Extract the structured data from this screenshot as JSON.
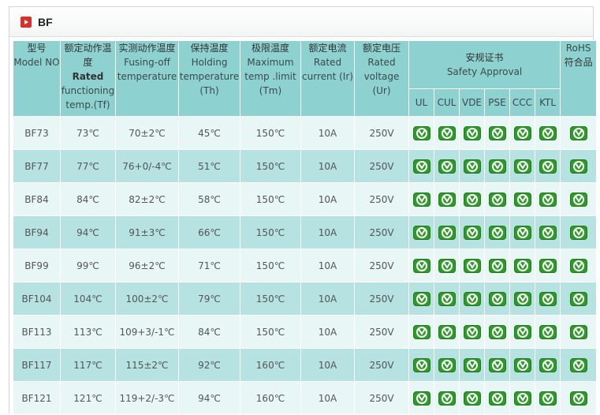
{
  "title": "BF",
  "header": {
    "col_model": {
      "cn": "型号",
      "en": "Model NO"
    },
    "col_rated": {
      "cn": "额定动作温度",
      "bold": "Rated",
      "en": "functioning temp.(Tf)"
    },
    "col_fusing": {
      "cn": "实测动作温度",
      "en": "Fusing-off temperature"
    },
    "col_holding": {
      "cn": "保持温度",
      "en": "Holding temperature (Th)"
    },
    "col_max": {
      "cn": "极限温度",
      "en": "Maximum temp .limit (Tm)"
    },
    "col_current": {
      "cn": "额定电流",
      "en": "Rated current (Ir)"
    },
    "col_voltage": {
      "cn": "额定电压",
      "en": "Rated voltage (Ur)"
    },
    "col_safety": {
      "cn": "安规证书",
      "en": "Safety Approval"
    },
    "col_rohs": {
      "en": "RoHS",
      "cn": "符合品"
    },
    "safety_subs": [
      "UL",
      "CUL",
      "VDE",
      "PSE",
      "CCC",
      "KTL"
    ]
  },
  "badge_icon": "approved-check-icon",
  "badge_color": "#2f9a2a",
  "rows": [
    {
      "model": "BF73",
      "rated": "73℃",
      "fusing": "70±2℃",
      "holding": "45℃",
      "max": "150℃",
      "current": "10A",
      "voltage": "250V"
    },
    {
      "model": "BF77",
      "rated": "77℃",
      "fusing": "76+0/-4℃",
      "holding": "51℃",
      "max": "150℃",
      "current": "10A",
      "voltage": "250V"
    },
    {
      "model": "BF84",
      "rated": "84℃",
      "fusing": "82±2℃",
      "holding": "58℃",
      "max": "150℃",
      "current": "10A",
      "voltage": "250V"
    },
    {
      "model": "BF94",
      "rated": "94℃",
      "fusing": "91±3℃",
      "holding": "66℃",
      "max": "150℃",
      "current": "10A",
      "voltage": "250V"
    },
    {
      "model": "BF99",
      "rated": "99℃",
      "fusing": "96±2℃",
      "holding": "71℃",
      "max": "150℃",
      "current": "10A",
      "voltage": "250V"
    },
    {
      "model": "BF104",
      "rated": "104℃",
      "fusing": "100±2℃",
      "holding": "79℃",
      "max": "150℃",
      "current": "10A",
      "voltage": "250V"
    },
    {
      "model": "BF113",
      "rated": "113℃",
      "fusing": "109+3/-1℃",
      "holding": "84℃",
      "max": "150℃",
      "current": "10A",
      "voltage": "250V"
    },
    {
      "model": "BF117",
      "rated": "117℃",
      "fusing": "115±2℃",
      "holding": "92℃",
      "max": "160℃",
      "current": "10A",
      "voltage": "250V"
    },
    {
      "model": "BF121",
      "rated": "121℃",
      "fusing": "119+2/-3℃",
      "holding": "94℃",
      "max": "160℃",
      "current": "10A",
      "voltage": "250V"
    }
  ]
}
